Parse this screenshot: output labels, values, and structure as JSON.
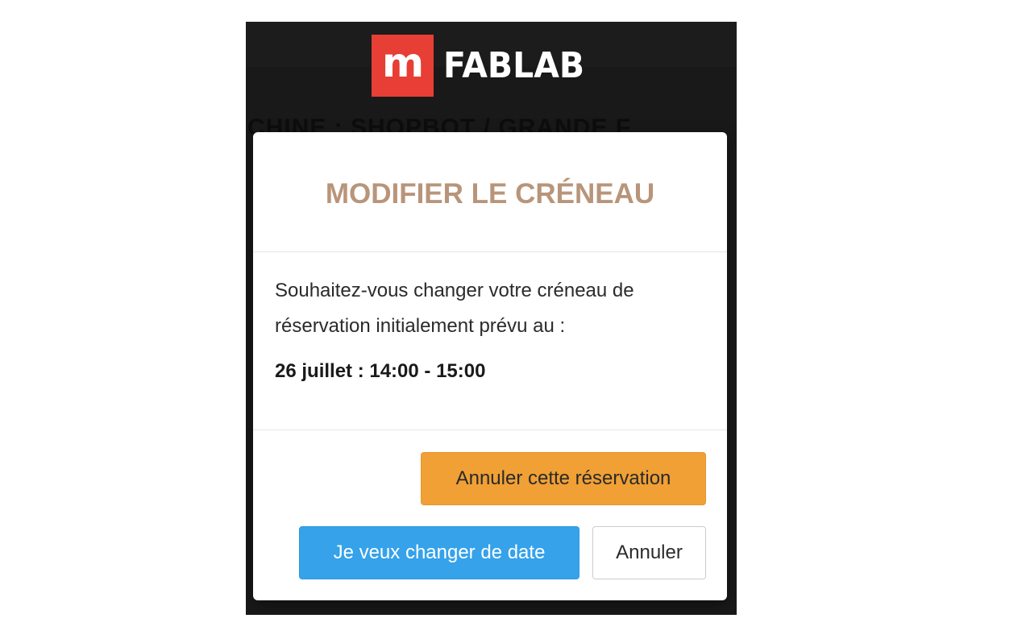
{
  "brand": {
    "logo_mark": "m",
    "logo_text": "FABLAB",
    "logo_color": "#e73f35"
  },
  "page": {
    "heading_partial": "CHINE : SHOPBOT / GRANDE F"
  },
  "modal": {
    "title": "MODIFIER LE CRÉNEAU",
    "title_color": "#b8957a",
    "message": "Souhaitez-vous changer votre créneau de réservation initialement prévu au :",
    "slot": "26 juillet : 14:00 - 15:00",
    "buttons": {
      "cancel_booking": "Annuler cette réservation",
      "change_date": "Je veux changer de date",
      "close": "Annuler"
    },
    "button_colors": {
      "cancel_booking": "#f0a035",
      "change_date": "#35a2ea",
      "close": "#ffffff"
    }
  }
}
